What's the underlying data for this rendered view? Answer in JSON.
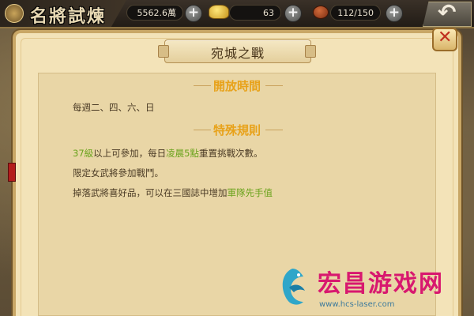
{
  "header": {
    "title": "名將試煉",
    "currency": {
      "value": "5562.6萬"
    },
    "gold": {
      "value": "63",
      "icon": "gold-ingot-icon"
    },
    "stamina": {
      "value": "112/150",
      "icon": "meat-icon"
    },
    "plus_label": "+",
    "back_label": "↶"
  },
  "dialog": {
    "title": "宛城之戰",
    "close_label": "✕",
    "sections": [
      {
        "heading": "開放時間",
        "lines": [
          "每週二、四、六、日"
        ]
      },
      {
        "heading": "特殊規則"
      }
    ],
    "rules": {
      "line1": {
        "level": "37級",
        "a": "以上可參加，每日",
        "time": "凌晨5點",
        "b": "重置挑戰次數。"
      },
      "line2": "限定女武將參加戰鬥。",
      "line3": {
        "a": "掉落武將喜好品，可以在三國誌中增加",
        "bonus": "軍隊先手值"
      }
    }
  },
  "watermark": {
    "name": "宏昌游戏网",
    "url": "www.hcs-laser.com"
  },
  "colors": {
    "highlight": "#6aa31c",
    "section_heading": "#e8a21a",
    "watermark": "#d8186f"
  }
}
